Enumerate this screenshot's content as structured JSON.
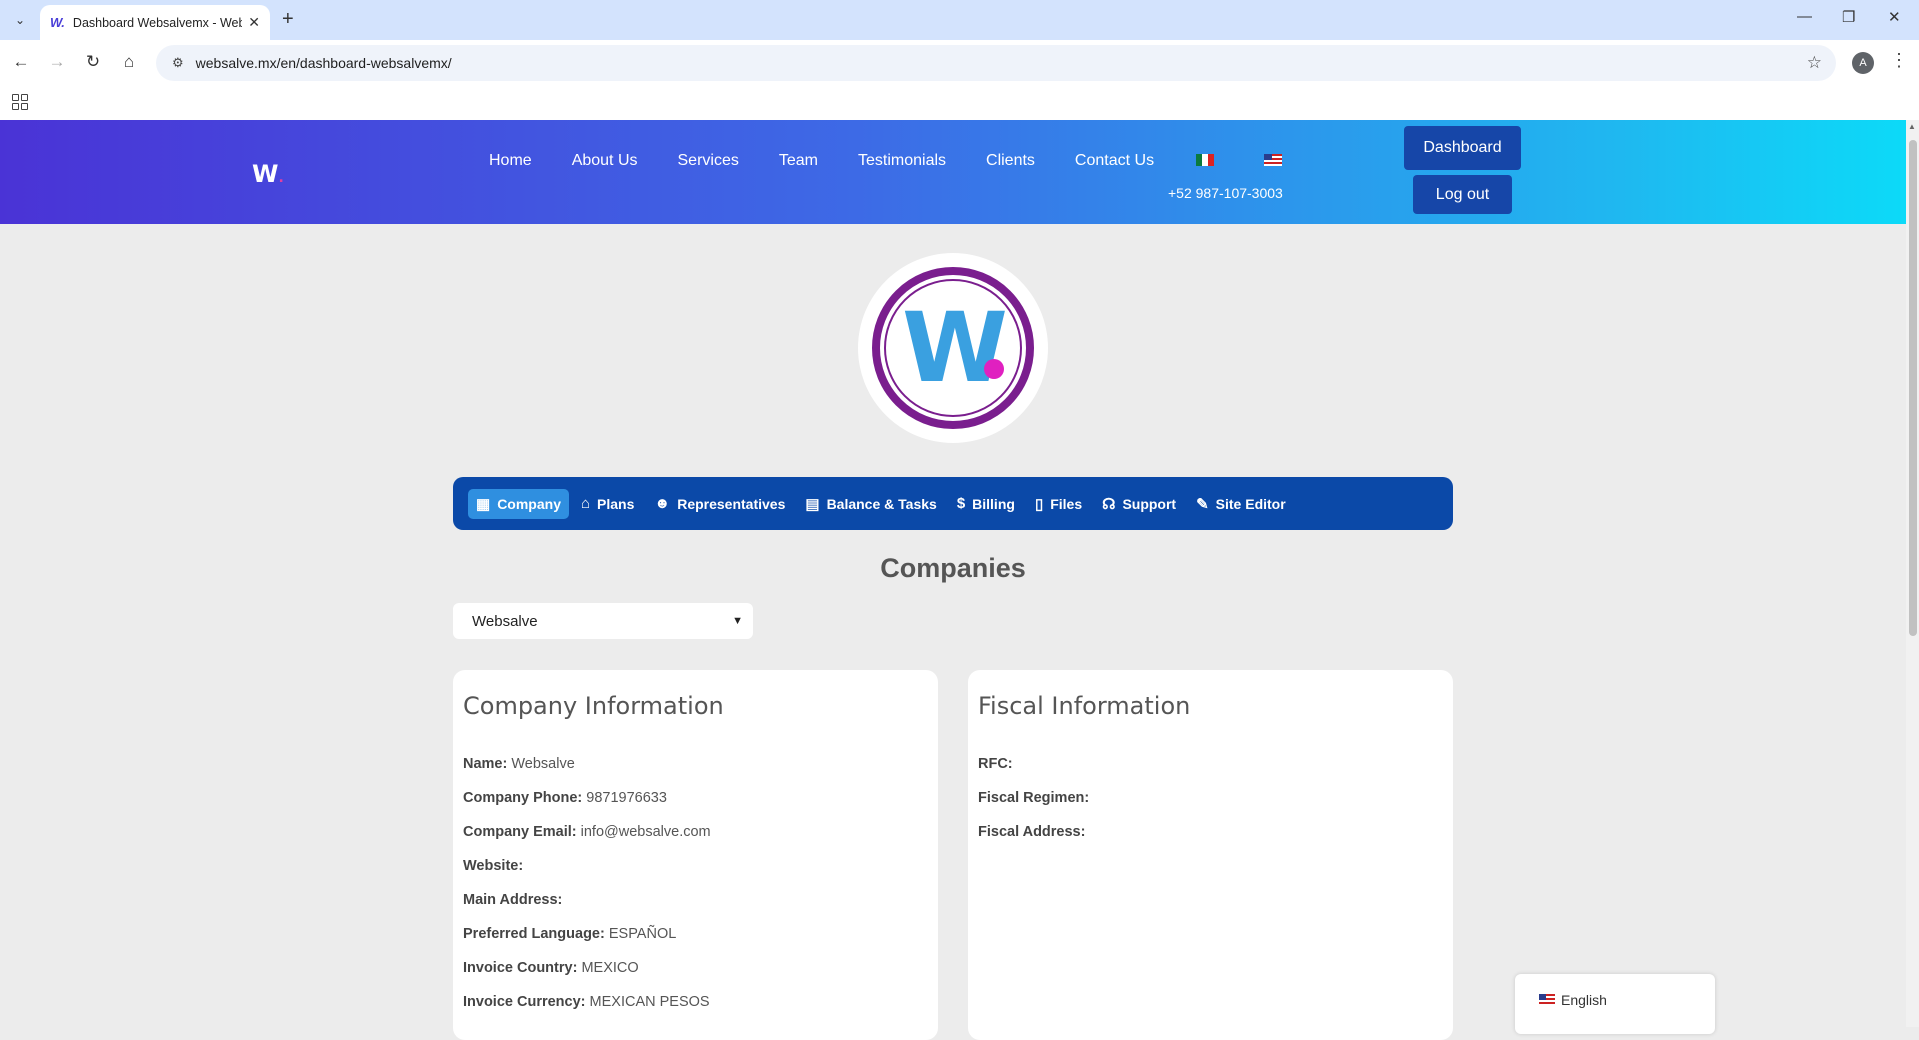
{
  "browser": {
    "tab_title": "Dashboard Websalvemx - Websalve",
    "url": "websalve.mx/en/dashboard-websalvemx/"
  },
  "header": {
    "logo_text": "W",
    "nav": [
      "Home",
      "About Us",
      "Services",
      "Team",
      "Testimonials",
      "Clients",
      "Contact Us"
    ],
    "phone": "+52 987-107-3003",
    "dashboard_label": "Dashboard",
    "logout_label": "Log out"
  },
  "dashboard_tabs": [
    {
      "label": "Company",
      "icon": "building-icon",
      "active": true
    },
    {
      "label": "Plans",
      "icon": "store-icon",
      "active": false
    },
    {
      "label": "Representatives",
      "icon": "people-icon",
      "active": false
    },
    {
      "label": "Balance & Tasks",
      "icon": "money-check-icon",
      "active": false
    },
    {
      "label": "Billing",
      "icon": "invoice-icon",
      "active": false
    },
    {
      "label": "Files",
      "icon": "file-icon",
      "active": false
    },
    {
      "label": "Support",
      "icon": "headset-icon",
      "active": false
    },
    {
      "label": "Site Editor",
      "icon": "pencil-icon",
      "active": false
    }
  ],
  "main": {
    "heading": "Companies",
    "company_select": "Websalve"
  },
  "company_info": {
    "title": "Company Information",
    "fields": [
      {
        "label": "Name:",
        "value": "Websalve"
      },
      {
        "label": "Company Phone:",
        "value": "9871976633"
      },
      {
        "label": "Company Email:",
        "value": "info@websalve.com"
      },
      {
        "label": "Website:",
        "value": ""
      },
      {
        "label": "Main Address:",
        "value": ""
      },
      {
        "label": "Preferred Language:",
        "value": "ESPAÑOL"
      },
      {
        "label": "Invoice Country:",
        "value": "MEXICO"
      },
      {
        "label": "Invoice Currency:",
        "value": "MEXICAN PESOS"
      }
    ]
  },
  "fiscal_info": {
    "title": "Fiscal Information",
    "fields": [
      {
        "label": "RFC:",
        "value": ""
      },
      {
        "label": "Fiscal Regimen:",
        "value": ""
      },
      {
        "label": "Fiscal Address:",
        "value": ""
      }
    ]
  },
  "language_widget": {
    "label": "English"
  },
  "colors": {
    "header_start": "#4a33d6",
    "header_end": "#0cdaf8",
    "tab_bar": "#0b49a8",
    "tab_active": "#2f8fe0",
    "button": "#1646a8"
  }
}
